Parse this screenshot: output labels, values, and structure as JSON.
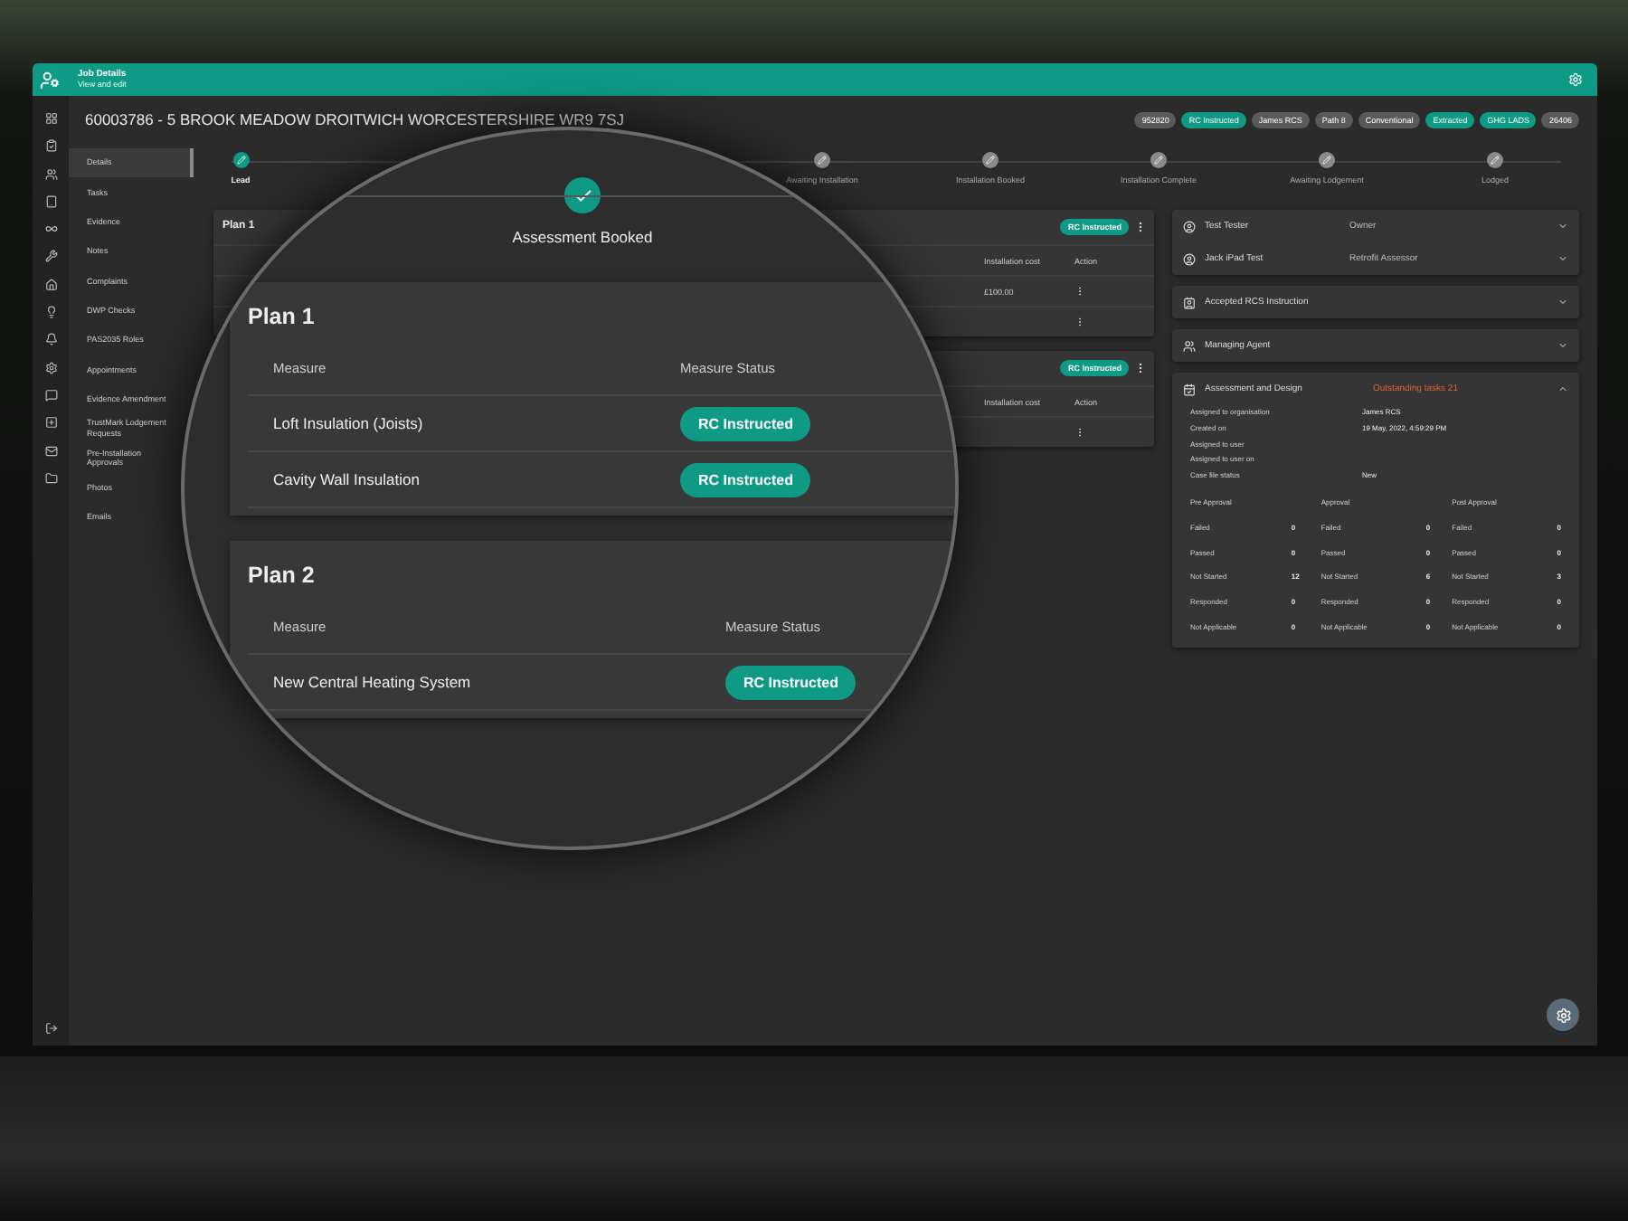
{
  "header": {
    "title": "Job Details",
    "subtitle": "View and edit"
  },
  "address": "60003786 - 5 BROOK MEADOW DROITWICH WORCESTERSHIRE WR9 7SJ",
  "chips": [
    {
      "label": "952820",
      "color": "#5a5a5a"
    },
    {
      "label": "RC Instructed",
      "color": "#0f9a85"
    },
    {
      "label": "James RCS",
      "color": "#5a5a5a"
    },
    {
      "label": "Path 8",
      "color": "#5a5a5a"
    },
    {
      "label": "Conventional",
      "color": "#5a5a5a"
    },
    {
      "label": "Extracted",
      "color": "#0f9a85"
    },
    {
      "label": "GHG LADS",
      "color": "#0f9a85"
    },
    {
      "label": "26406",
      "color": "#5a5a5a"
    }
  ],
  "sidebar": {
    "items": [
      {
        "label": "Details",
        "selected": true
      },
      {
        "label": "Tasks",
        "selected": false
      },
      {
        "label": "Evidence",
        "selected": false
      },
      {
        "label": "Notes",
        "selected": false
      },
      {
        "label": "Complaints",
        "selected": false
      },
      {
        "label": "DWP Checks",
        "selected": false
      },
      {
        "label": "PAS2035 Roles",
        "selected": false
      },
      {
        "label": "Appointments",
        "selected": false
      },
      {
        "label": "Evidence Amendment",
        "selected": false
      },
      {
        "label": "TrustMark Lodgement Requests",
        "selected": false
      },
      {
        "label": "Pre-Installation Approvals",
        "selected": false
      },
      {
        "label": "Photos",
        "selected": false
      },
      {
        "label": "Emails",
        "selected": false
      }
    ]
  },
  "steps": [
    {
      "label": "Lead",
      "done": true
    },
    {
      "label": "Awaiting Installation",
      "done": false
    },
    {
      "label": "Installation Booked",
      "done": false
    },
    {
      "label": "Installation Complete",
      "done": false
    },
    {
      "label": "Awaiting Lodgement",
      "done": false
    },
    {
      "label": "Lodged",
      "done": false
    }
  ],
  "plan_cards": [
    {
      "title": "Plan 1",
      "status": "RC Instructed",
      "columns": [
        "Installation cost",
        "Action"
      ],
      "rows": [
        {
          "cost": "£100.00"
        },
        {}
      ]
    },
    {
      "status": "RC Instructed",
      "columns": [
        "Installation cost",
        "Action"
      ],
      "rows": [
        {}
      ]
    }
  ],
  "contacts": [
    {
      "name": "Test Tester",
      "role": "Owner"
    },
    {
      "name": "Jack iPad Test",
      "role": "Retrofit Assessor"
    }
  ],
  "sections": [
    {
      "kind": "instruction",
      "title": "Accepted RCS Instruction",
      "expanded": false
    },
    {
      "kind": "agent",
      "title": "Managing Agent",
      "expanded": false
    }
  ],
  "assessment": {
    "title": "Assessment and Design",
    "alert": "Outstanding tasks 21",
    "expanded": true,
    "details": [
      {
        "label": "Assigned to organisation",
        "value": "James RCS"
      },
      {
        "label": "Created on",
        "value": "19 May, 2022, 4:59:29 PM"
      },
      {
        "label": "Assigned to user"
      },
      {
        "label": "Assigned to user on"
      },
      {
        "label": "Case file status",
        "value": "New"
      }
    ],
    "groups": [
      {
        "title": "Pre Approval",
        "counts": [
          {
            "label": "Failed",
            "value": "0"
          },
          {
            "label": "Passed",
            "value": "0"
          },
          {
            "label": "Not Started",
            "value": "12"
          },
          {
            "label": "Responded",
            "value": "0"
          },
          {
            "label": "Not Applicable",
            "value": "0"
          }
        ]
      },
      {
        "title": "Approval",
        "counts": [
          {
            "label": "Failed",
            "value": "0"
          },
          {
            "label": "Passed",
            "value": "0"
          },
          {
            "label": "Not Started",
            "value": "6"
          },
          {
            "label": "Responded",
            "value": "0"
          },
          {
            "label": "Not Applicable",
            "value": "0"
          }
        ]
      },
      {
        "title": "Post Approval",
        "counts": [
          {
            "label": "Failed",
            "value": "0"
          },
          {
            "label": "Passed",
            "value": "0"
          },
          {
            "label": "Not Started",
            "value": "3"
          },
          {
            "label": "Responded",
            "value": "0"
          },
          {
            "label": "Not Applicable",
            "value": "0"
          }
        ]
      }
    ]
  },
  "magnifier": {
    "step": {
      "label": "Assessment Booked",
      "done": true
    },
    "plans": [
      {
        "title": "Plan 1",
        "columns": [
          "Measure",
          "Measure Status"
        ],
        "rows": [
          {
            "measure": "Loft Insulation (Joists)",
            "status": "RC Instructed"
          },
          {
            "measure": "Cavity Wall Insulation",
            "status": "RC Instructed"
          }
        ]
      },
      {
        "title": "Plan 2",
        "columns": [
          "Measure",
          "Measure Status"
        ],
        "rows": [
          {
            "measure": "New Central Heating System",
            "status": "RC Instructed"
          }
        ]
      }
    ]
  }
}
